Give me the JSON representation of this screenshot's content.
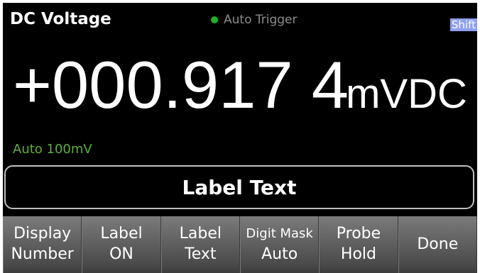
{
  "header": {
    "mode_title": "DC Voltage",
    "trigger_label": "Auto Trigger",
    "shift_label": "Shift"
  },
  "reading": {
    "main": "+000.917 4",
    "unit": "mVDC",
    "range": "Auto 100mV"
  },
  "label_box": {
    "text": "Label Text"
  },
  "softkeys": [
    {
      "line1": "Display",
      "line2": "Number"
    },
    {
      "line1": "Label",
      "line2": "ON"
    },
    {
      "line1": "Label",
      "line2": "Text"
    },
    {
      "line1": "Digit Mask",
      "line2": "Auto"
    },
    {
      "line1": "Probe",
      "line2": "Hold"
    },
    {
      "line1": "Done",
      "line2": ""
    }
  ],
  "colors": {
    "trigger_indicator": "#1bb51b",
    "range_text": "#5fae3a",
    "shift_badge": "#8ea0f0"
  }
}
